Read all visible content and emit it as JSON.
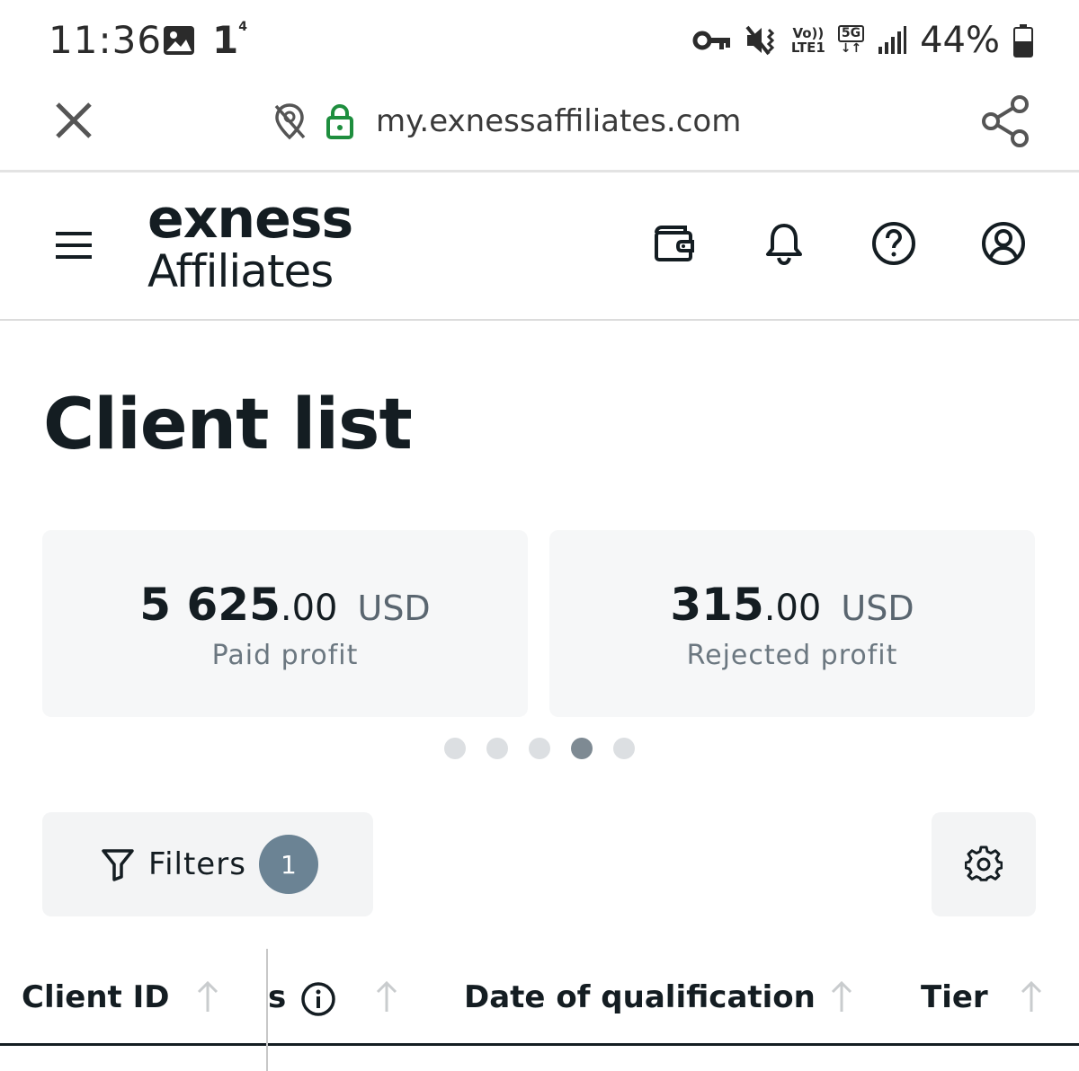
{
  "status_bar": {
    "time": "11:36",
    "notification_count": "1",
    "notification_sup": "4",
    "volte_label_top": "Vo))",
    "volte_label_bottom": "LTE1",
    "network_label": "5G",
    "battery_percent": "44%",
    "icons": [
      "gallery-icon",
      "key-icon",
      "mute-vibrate-icon",
      "signal-icon",
      "battery-icon"
    ]
  },
  "browser": {
    "url": "my.exnessaffiliates.com",
    "icons": [
      "close-icon",
      "tracking-off-icon",
      "lock-icon",
      "share-icon"
    ],
    "lock_color": "#1e8e3e"
  },
  "header": {
    "logo_top": "exness",
    "logo_bottom": "Affiliates",
    "icons": [
      "menu-icon",
      "wallet-icon",
      "bell-icon",
      "help-icon",
      "account-icon"
    ]
  },
  "page": {
    "title": "Client list"
  },
  "cards": [
    {
      "amount_int": "5 625",
      "amount_dec": ".00",
      "currency": "USD",
      "label": "Paid profit"
    },
    {
      "amount_int": "315",
      "amount_dec": ".00",
      "currency": "USD",
      "label": "Rejected profit"
    }
  ],
  "carousel": {
    "total_dots": 5,
    "active_index": 3
  },
  "toolbar": {
    "filters_label": "Filters",
    "filters_count": "1"
  },
  "table": {
    "columns": [
      {
        "label": "Client ID"
      },
      {
        "label": "s"
      },
      {
        "label": "Date of qualification"
      },
      {
        "label": "Tier"
      }
    ]
  },
  "colors": {
    "text_primary": "#141d22",
    "card_bg": "#f6f7f8",
    "badge_bg": "#6b8394",
    "dot_active": "#7e8a93",
    "dot_inactive": "#dcdfe2"
  }
}
